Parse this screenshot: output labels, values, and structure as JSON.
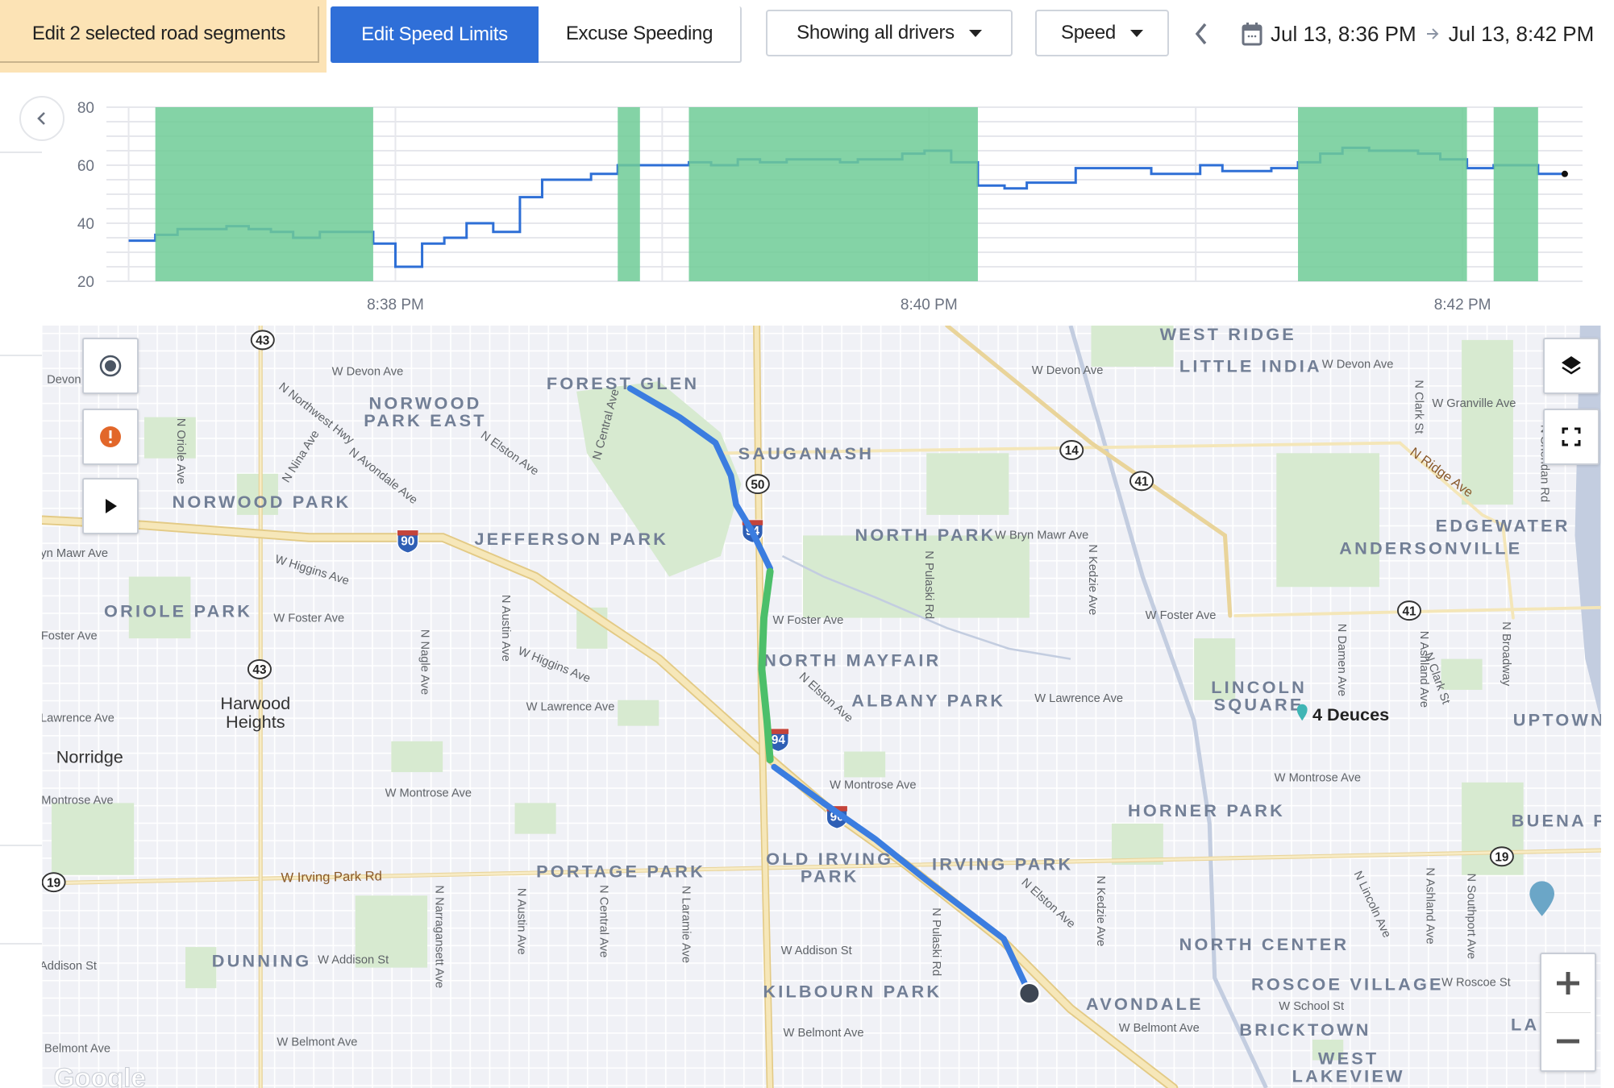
{
  "toolbar": {
    "edit_segments_label": "Edit 2 selected road segments",
    "edit_speed_limits_label": "Edit Speed Limits",
    "excuse_speeding_label": "Excuse Speeding",
    "drivers_dropdown": "Showing all drivers",
    "metric_dropdown": "Speed",
    "date_start": "Jul 13, 8:36 PM",
    "date_end": "Jul 13, 8:42 PM",
    "icons": [
      "caret-down-icon",
      "chevron-left-icon",
      "calendar-icon",
      "arrow-right-icon"
    ],
    "accent_color": "#2f6fd8",
    "selection_color": "#fce3b5"
  },
  "chart_data": {
    "type": "line",
    "step": true,
    "title": "",
    "xlabel": "",
    "ylabel": "",
    "ylim": [
      20,
      80
    ],
    "yticks": [
      20,
      40,
      60,
      80
    ],
    "xlim": [
      "8:36:55",
      "8:42:27"
    ],
    "xticks": [
      "8:38 PM",
      "8:40 PM",
      "8:42 PM"
    ],
    "grid": true,
    "line_color": "#2e6fd6",
    "band_color": "#6fcb96",
    "series": [
      {
        "x": [
          "8:37:00",
          "8:37:06",
          "8:37:11",
          "8:37:22",
          "8:37:27",
          "8:37:32",
          "8:37:37",
          "8:37:43",
          "8:37:49",
          "8:37:55",
          "8:38:00",
          "8:38:06",
          "8:38:11",
          "8:38:16",
          "8:38:22",
          "8:38:28",
          "8:38:33",
          "8:38:39",
          "8:38:44",
          "8:38:50",
          "8:38:55",
          "8:39:06",
          "8:39:11",
          "8:39:17",
          "8:39:22",
          "8:39:28",
          "8:39:40",
          "8:39:44",
          "8:39:49",
          "8:39:54",
          "8:39:59",
          "8:40:05",
          "8:40:11",
          "8:40:17",
          "8:40:22",
          "8:40:33",
          "8:40:44",
          "8:40:50",
          "8:41:01",
          "8:41:06",
          "8:41:17",
          "8:41:23",
          "8:41:28",
          "8:41:33",
          "8:41:39",
          "8:41:50",
          "8:41:55",
          "8:42:01",
          "8:42:07",
          "8:42:17",
          "8:42:23"
        ],
        "y": [
          34,
          36,
          38,
          39,
          38,
          37,
          35,
          37,
          37,
          33,
          25,
          33,
          35,
          40,
          37,
          49,
          55,
          55,
          57,
          60,
          60,
          61,
          60,
          62,
          61,
          62,
          61,
          62,
          62,
          64,
          65,
          61,
          53,
          52,
          54,
          59,
          59,
          57,
          60,
          58,
          59,
          61,
          64,
          66,
          65,
          64,
          62,
          59,
          60,
          57,
          57
        ]
      }
    ],
    "speeding_intervals": [
      [
        "8:37:06",
        "8:37:55"
      ],
      [
        "8:38:50",
        "8:38:55"
      ],
      [
        "8:39:06",
        "8:40:11"
      ],
      [
        "8:41:23",
        "8:42:01"
      ],
      [
        "8:42:07",
        "8:42:17"
      ]
    ]
  },
  "map": {
    "neighborhoods": [
      "WEST RIDGE",
      "LITTLE INDIA",
      "FOREST GLEN",
      "NORWOOD\nPARK EAST",
      "SAUGANASH",
      "NORWOOD PARK",
      "JEFFERSON PARK",
      "NORTH PARK",
      "EDGEWATER",
      "ANDERSONVILLE",
      "ORIOLE PARK",
      "NORTH MAYFAIR",
      "ALBANY PARK",
      "LINCOLN\nSQUARE",
      "UPTOWN",
      "HORNER PARK",
      "BUENA P",
      "OLD IRVING\nPARK",
      "IRVING PARK",
      "PORTAGE PARK",
      "NORTH CENTER",
      "DUNNING",
      "KILBOURN PARK",
      "ROSCOE VILLAGE",
      "AVONDALE",
      "BRICKTOWN",
      "LAKE VI",
      "WEST\nLAKEVIEW"
    ],
    "cities": [
      "Harwood\nHeights",
      "Norridge"
    ],
    "streets": [
      "W Devon Ave",
      "Devon",
      "W Devon Ave",
      "W Devon Ave",
      "W Granville Ave",
      "N Northwest Hwy",
      "N Avondale Ave",
      "N Elston Ave",
      "N Nina Ave",
      "N Oriole Ave",
      "N Central Ave",
      "W Bryn Mawr Ave",
      "yn Mawr Ave",
      "W Higgins Ave",
      "W Higgins Ave",
      "W Foster Ave",
      "Foster Ave",
      "W Foster Ave",
      "W Foster Ave",
      "N Austin Ave",
      "N Nagle Ave",
      "N Pulaski Rd",
      "N Kedzie Ave",
      "N Damen Ave",
      "N Ashland Ave",
      "N Clark St",
      "N Broadway",
      "N Clark St",
      "N Sheridan Rd",
      "N Elston Ave",
      "N Elston Ave",
      "W Lawrence Ave",
      "Lawrence Ave",
      "W Lawrence Ave",
      "W Montrose Ave",
      "Montrose Ave",
      "W Montrose Ave",
      "W Montrose Ave",
      "W Addison St",
      "Addison St",
      "W Addison St",
      "W Belmont Ave",
      "Belmont Ave",
      "W Belmont Ave",
      "W Belmont Ave",
      "W Roscoe St",
      "W School St",
      "N Narragansett Ave",
      "N Austin Ave",
      "N Central Ave",
      "N Laramie Ave",
      "N Pulaski Rd",
      "N Kedzie Ave",
      "N Lincoln Ave",
      "N Ashland Ave",
      "N Southport Ave"
    ],
    "major_roads": [
      "W Irving Park Rd",
      "N Ridge Ave"
    ],
    "shields": [
      "43",
      "43",
      "50",
      "14",
      "41",
      "41",
      "19",
      "19",
      "90",
      "94",
      "94",
      "90"
    ],
    "poi": "4 Deuces",
    "attribution": "Google",
    "route_color": "#3b7de0",
    "selected_segment_color": "#4cbf6a",
    "controls": {
      "recenter": "target-icon",
      "alerts": "alert-icon",
      "play": "play-icon",
      "layers": "layers-icon",
      "fullscreen": "fullscreen-icon",
      "zoom_in": "plus-icon",
      "zoom_out": "minus-icon"
    }
  }
}
